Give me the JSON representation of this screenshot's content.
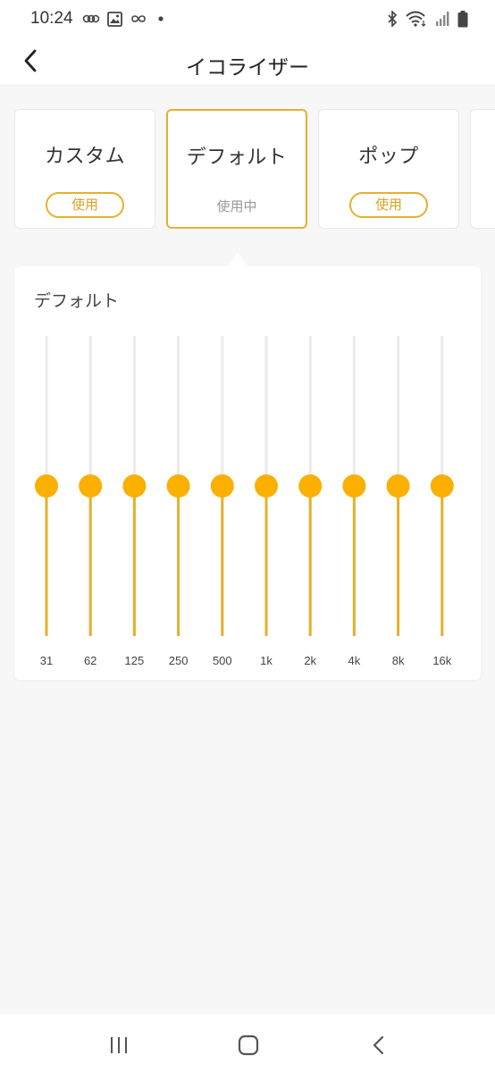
{
  "status_bar": {
    "time": "10:24",
    "left_icons": [
      "link-icon",
      "image-icon",
      "infinity-icon",
      "dot-icon"
    ],
    "right_icons": [
      "bluetooth-icon",
      "wifi-icon",
      "signal-icon",
      "battery-icon"
    ]
  },
  "header": {
    "title": "イコライザー",
    "back_icon": "chevron-left-icon"
  },
  "presets": [
    {
      "name": "カスタム",
      "button": "使用",
      "selected": false
    },
    {
      "name": "デフォルト",
      "status": "使用中",
      "selected": true
    },
    {
      "name": "ポップ",
      "button": "使用",
      "selected": false
    }
  ],
  "equalizer": {
    "title": "デフォルト",
    "bands": [
      "31",
      "62",
      "125",
      "250",
      "500",
      "1k",
      "2k",
      "4k",
      "8k",
      "16k"
    ],
    "levels": [
      0.5,
      0.5,
      0.5,
      0.5,
      0.5,
      0.5,
      0.5,
      0.5,
      0.5,
      0.5
    ]
  },
  "colors": {
    "accent": "#e3b12c",
    "knob": "#fbb000",
    "track": "#ebebeb",
    "background": "#f7f7f7"
  },
  "nav_bar": {
    "icons": [
      "recent-apps-icon",
      "home-icon",
      "back-icon"
    ]
  }
}
